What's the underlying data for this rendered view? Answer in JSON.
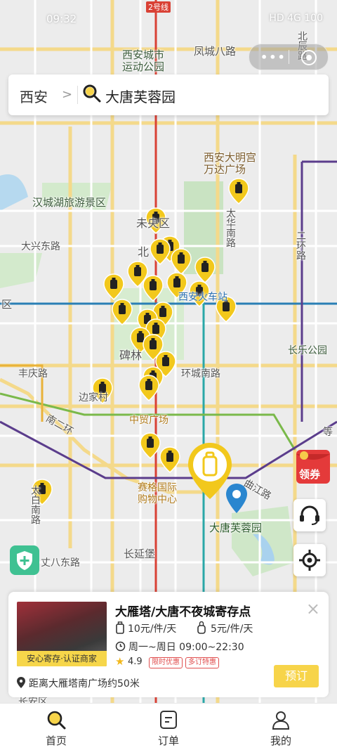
{
  "status_bar": {
    "time": "09:32",
    "icons_right": "HD 4G 100"
  },
  "search": {
    "city": "西安",
    "query": "大唐芙蓉园",
    "city_chevron": ">"
  },
  "map": {
    "labels": {
      "line2": "2号线",
      "xian_stadium": "西安城市\n运动公园",
      "fengcheng8": "凤城八路",
      "beichen": "北辰路",
      "damingong": "西安大明宫\n万达广场",
      "hancheng": "汉城湖旅游景区",
      "daxingdong": "大兴东路",
      "weiyang": "未央区",
      "dahua": "太华南路",
      "erhuan": "二环路",
      "bei": "北",
      "chezhan": "西安火车站",
      "qu": "区",
      "beilin": "碑林",
      "huanchengnan": "环城南路",
      "changle": "长乐公园",
      "fengqing": "丰庆路",
      "bianjia": "边家村",
      "zhongmao": "中贸广场",
      "nanerhuan": "南二环",
      "deng": "等",
      "saige": "赛格国际\n购物中心",
      "qujiang": "曲江路",
      "datang": "大唐芙蓉园",
      "dazhai": "太白南路",
      "changyan": "长延堡",
      "zhangba": "丈八东路",
      "changan": "长安区"
    }
  },
  "coupon": {
    "label": "领券"
  },
  "card": {
    "title": "大雁塔/大唐不夜城寄存点",
    "badge": "安心寄存·认证商家",
    "price_large": "10元/件/天",
    "price_small": "5元/件/天",
    "hours": "周一~周日 09:00~22:30",
    "rating": "4.9",
    "tag1": "限时优惠",
    "tag2": "多订特惠",
    "distance": "距离大雁塔南广场约50米",
    "book": "预订",
    "close": "×"
  },
  "tabs": [
    {
      "label": "首页"
    },
    {
      "label": "订单"
    },
    {
      "label": "我的"
    }
  ],
  "colors": {
    "accent": "#f7d44a",
    "pin": "#f2c81c",
    "metro_red": "#d94135",
    "metro_blue": "#2a7fb5",
    "green": "#3fc192"
  },
  "pin_count": 32
}
